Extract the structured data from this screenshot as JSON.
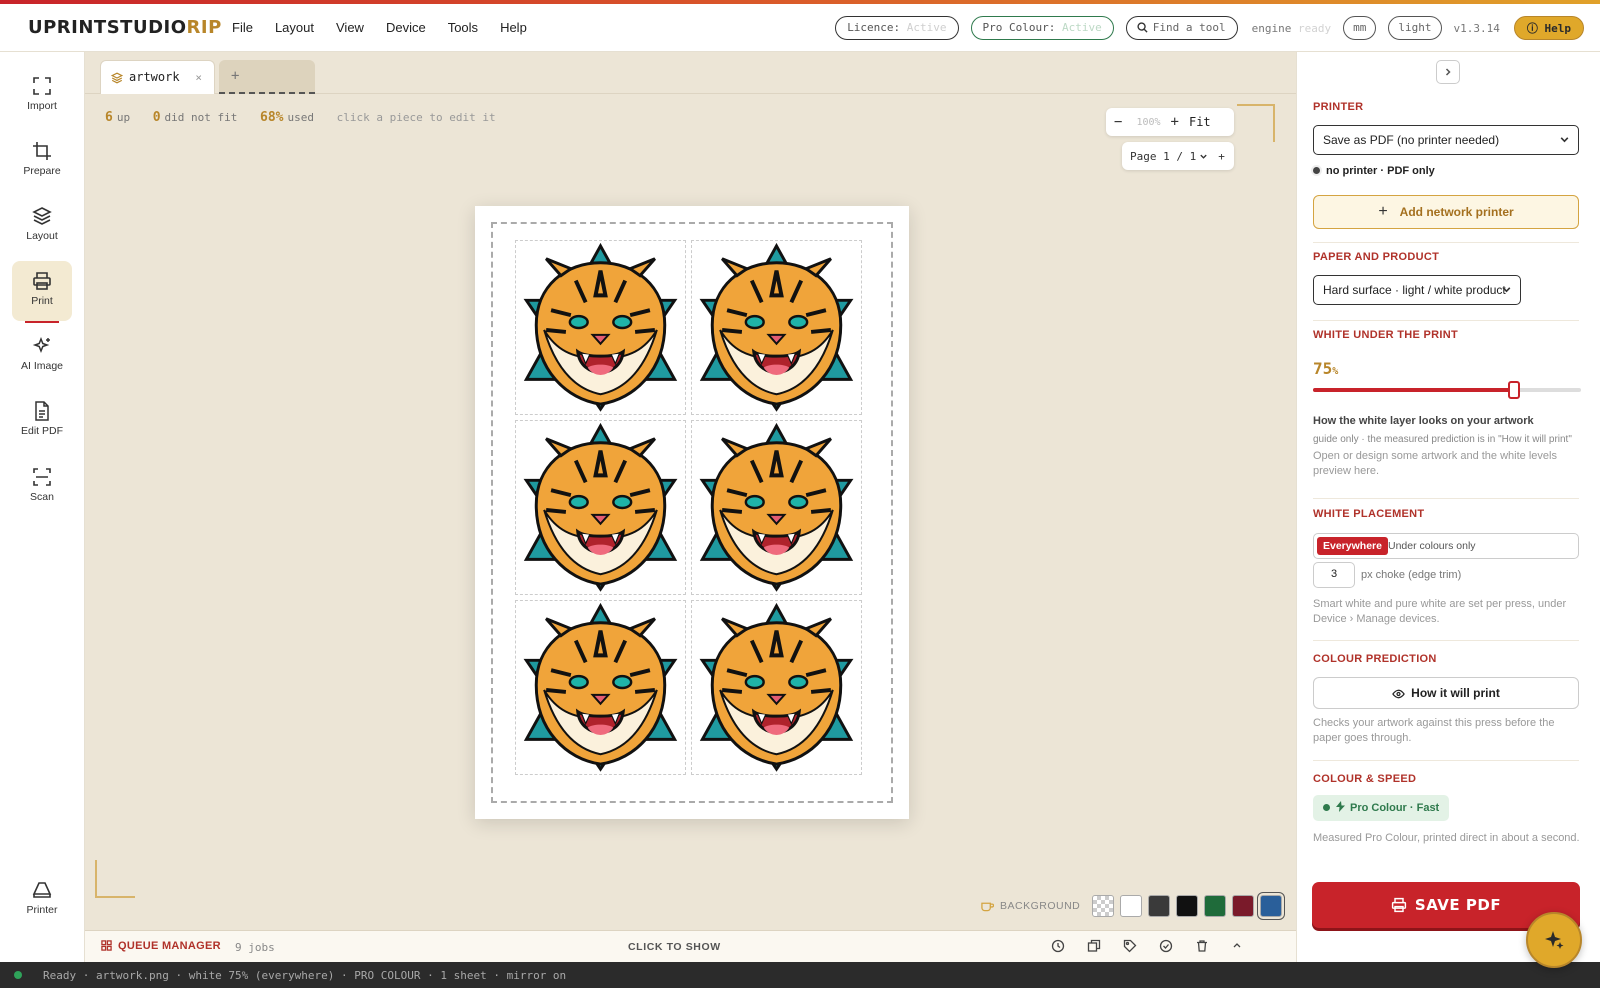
{
  "app": {
    "logo_part1": "UPRINTSTUDIO",
    "logo_part2": "RIP",
    "menu": [
      "File",
      "Layout",
      "View",
      "Device",
      "Tools",
      "Help"
    ],
    "licence_label": "Licence:",
    "licence_status": "Active",
    "pro_colour_label": "Pro Colour:",
    "pro_colour_status": "Active",
    "find_tool": "Find a tool",
    "engine_label": "engine",
    "engine_status": "ready",
    "units": "mm",
    "theme": "light",
    "version": "v1.3.14",
    "help": "Help"
  },
  "sidebar": {
    "items": [
      {
        "label": "Import",
        "icon": "import-icon"
      },
      {
        "label": "Prepare",
        "icon": "crop-icon"
      },
      {
        "label": "Layout",
        "icon": "layers-icon"
      },
      {
        "label": "Print",
        "icon": "printer-icon",
        "active": true
      },
      {
        "label": "AI Image",
        "icon": "sparkle-icon"
      },
      {
        "label": "Edit PDF",
        "icon": "document-icon"
      },
      {
        "label": "Scan",
        "icon": "scan-icon"
      }
    ],
    "bottom": {
      "label": "Printer",
      "icon": "printer-device-icon"
    }
  },
  "canvas": {
    "tab_name": "artwork",
    "tab_close": "×",
    "add_tab": "+",
    "stats": {
      "up_count": "6",
      "up_label": "up",
      "nofit_count": "0",
      "nofit_label": "did not fit",
      "used_pct": "68%",
      "used_label": "used",
      "hint": "click a piece to edit it"
    },
    "zoom": {
      "minus": "−",
      "value": "100%",
      "plus": "+",
      "fit": "Fit"
    },
    "page": {
      "label": "Page",
      "current": "1",
      "sep": "/",
      "total": "1",
      "add": "+"
    },
    "pieces": 6,
    "background_label": "BACKGROUND",
    "background_swatches": [
      "transparent",
      "#ffffff",
      "#3a3a3a",
      "#111111",
      "#1f6b3a",
      "#7a1a2a",
      "#2a5f9a"
    ],
    "background_selected_index": 6
  },
  "queue": {
    "title": "QUEUE MANAGER",
    "jobs": "9 jobs",
    "show": "CLICK TO SHOW"
  },
  "statusbar": {
    "text": "Ready · artwork.png · white 75% (everywhere) · PRO COLOUR · 1 sheet · mirror on"
  },
  "panel": {
    "printer_title": "PRINTER",
    "printer_value": "Save as PDF (no printer needed)",
    "printer_note": "no printer · PDF only",
    "add_network": "Add network printer",
    "paper_title": "PAPER AND PRODUCT",
    "paper_value": "Hard surface · light / white product",
    "white_title": "WHITE UNDER THE PRINT",
    "white_value": "75",
    "white_unit": "%",
    "white_fraction": 0.75,
    "white_look_title": "How the white layer looks on your artwork",
    "white_look_note": "guide only · the measured prediction is in \"How it will print\"",
    "white_look_body": "Open or design some artwork and the white levels preview here.",
    "placement_title": "WHITE PLACEMENT",
    "placement_on": "Everywhere",
    "placement_off": "Under colours only",
    "choke_value": "3",
    "choke_label": "px choke (edge trim)",
    "placement_note": "Smart white and pure white are set per press, under Device › Manage devices.",
    "prediction_title": "COLOUR PREDICTION",
    "prediction_btn": "How it will print",
    "prediction_note": "Checks your artwork against this press before the paper goes through.",
    "speed_title": "COLOUR & SPEED",
    "speed_badge": "Pro Colour · Fast",
    "speed_note": "Measured Pro Colour, printed direct in about a second.",
    "save": "SAVE PDF"
  },
  "colors": {
    "accent_red": "#c8232a",
    "accent_gold": "#b8862a",
    "canvas_bg": "#ece5d6"
  }
}
